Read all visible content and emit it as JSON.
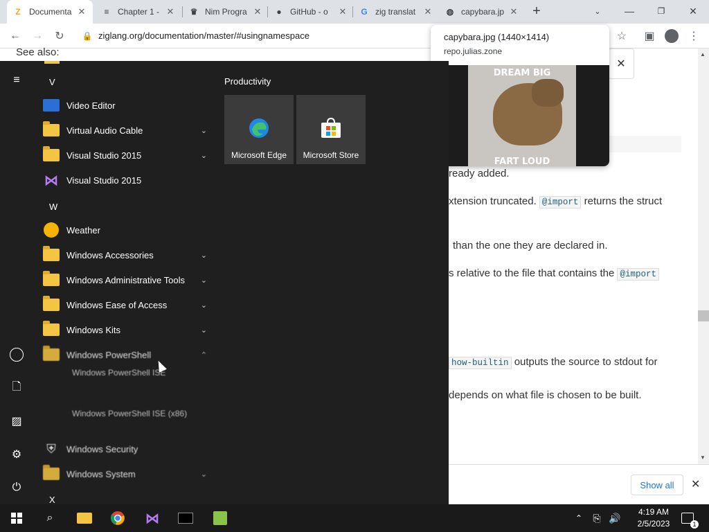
{
  "browser": {
    "tabs": [
      {
        "title": "Documenta",
        "icon": "zig-logo-icon"
      },
      {
        "title": "Chapter 1 -",
        "icon": "document-lines-icon"
      },
      {
        "title": "Nim Progra",
        "icon": "nim-crown-icon"
      },
      {
        "title": "GitHub - o",
        "icon": "github-icon"
      },
      {
        "title": "zig translat",
        "icon": "google-icon"
      },
      {
        "title": "capybara.jp",
        "icon": "globe-icon"
      }
    ],
    "url": "ziglang.org/documentation/master/#usingnamespace"
  },
  "page": {
    "see_also": "See also:",
    "lines": [
      {
        "text": "ready added."
      },
      {
        "pre": "xtension truncated.",
        "code": "@import",
        "post": "returns the struct"
      },
      {
        "text": "than the one they are declared in."
      },
      {
        "pre": "s relative to the file that contains the",
        "code": "@import",
        "post": ""
      },
      {
        "pre": "",
        "code": "how-builtin",
        "post": "outputs the source to stdout for"
      },
      {
        "text": "depends on what file is chosen to be built."
      }
    ]
  },
  "image_tooltip": {
    "filename": "capybara.jpg (1440×1414)",
    "domain": "repo.julias.zone",
    "caption_top": "DREAM BIG",
    "caption_bottom": "FART LOUD"
  },
  "download_bar": {
    "show_all": "Show all"
  },
  "start_menu": {
    "letters": {
      "v": "V",
      "w": "W",
      "x": "X"
    },
    "apps": [
      {
        "label": "Video Editor",
        "icon": "video-editor-icon"
      },
      {
        "label": "Virtual Audio Cable",
        "icon": "folder-icon"
      },
      {
        "label": "Visual Studio 2015",
        "icon": "folder-icon"
      },
      {
        "label": "Visual Studio 2015",
        "icon": "visual-studio-icon"
      },
      {
        "label": "Weather",
        "icon": "weather-icon"
      },
      {
        "label": "Windows Accessories",
        "icon": "folder-icon"
      },
      {
        "label": "Windows Administrative Tools",
        "icon": "folder-icon"
      },
      {
        "label": "Windows Ease of Access",
        "icon": "folder-icon"
      },
      {
        "label": "Windows Kits",
        "icon": "folder-icon"
      },
      {
        "label": "Windows PowerShell",
        "icon": "folder-icon"
      },
      {
        "label": "Windows Security",
        "icon": "shield-icon"
      },
      {
        "label": "Windows System",
        "icon": "folder-icon"
      }
    ],
    "sub_items": [
      "Windows PowerShell ISE",
      "Windows PowerShell ISE (x86)"
    ],
    "tiles_header": "Productivity",
    "tiles": [
      {
        "label": "Microsoft Edge",
        "icon": "edge-icon"
      },
      {
        "label": "Microsoft Store",
        "icon": "store-icon"
      }
    ]
  },
  "taskbar": {
    "time": "4:19 AM",
    "date": "2/5/2023",
    "notification_count": "1"
  }
}
